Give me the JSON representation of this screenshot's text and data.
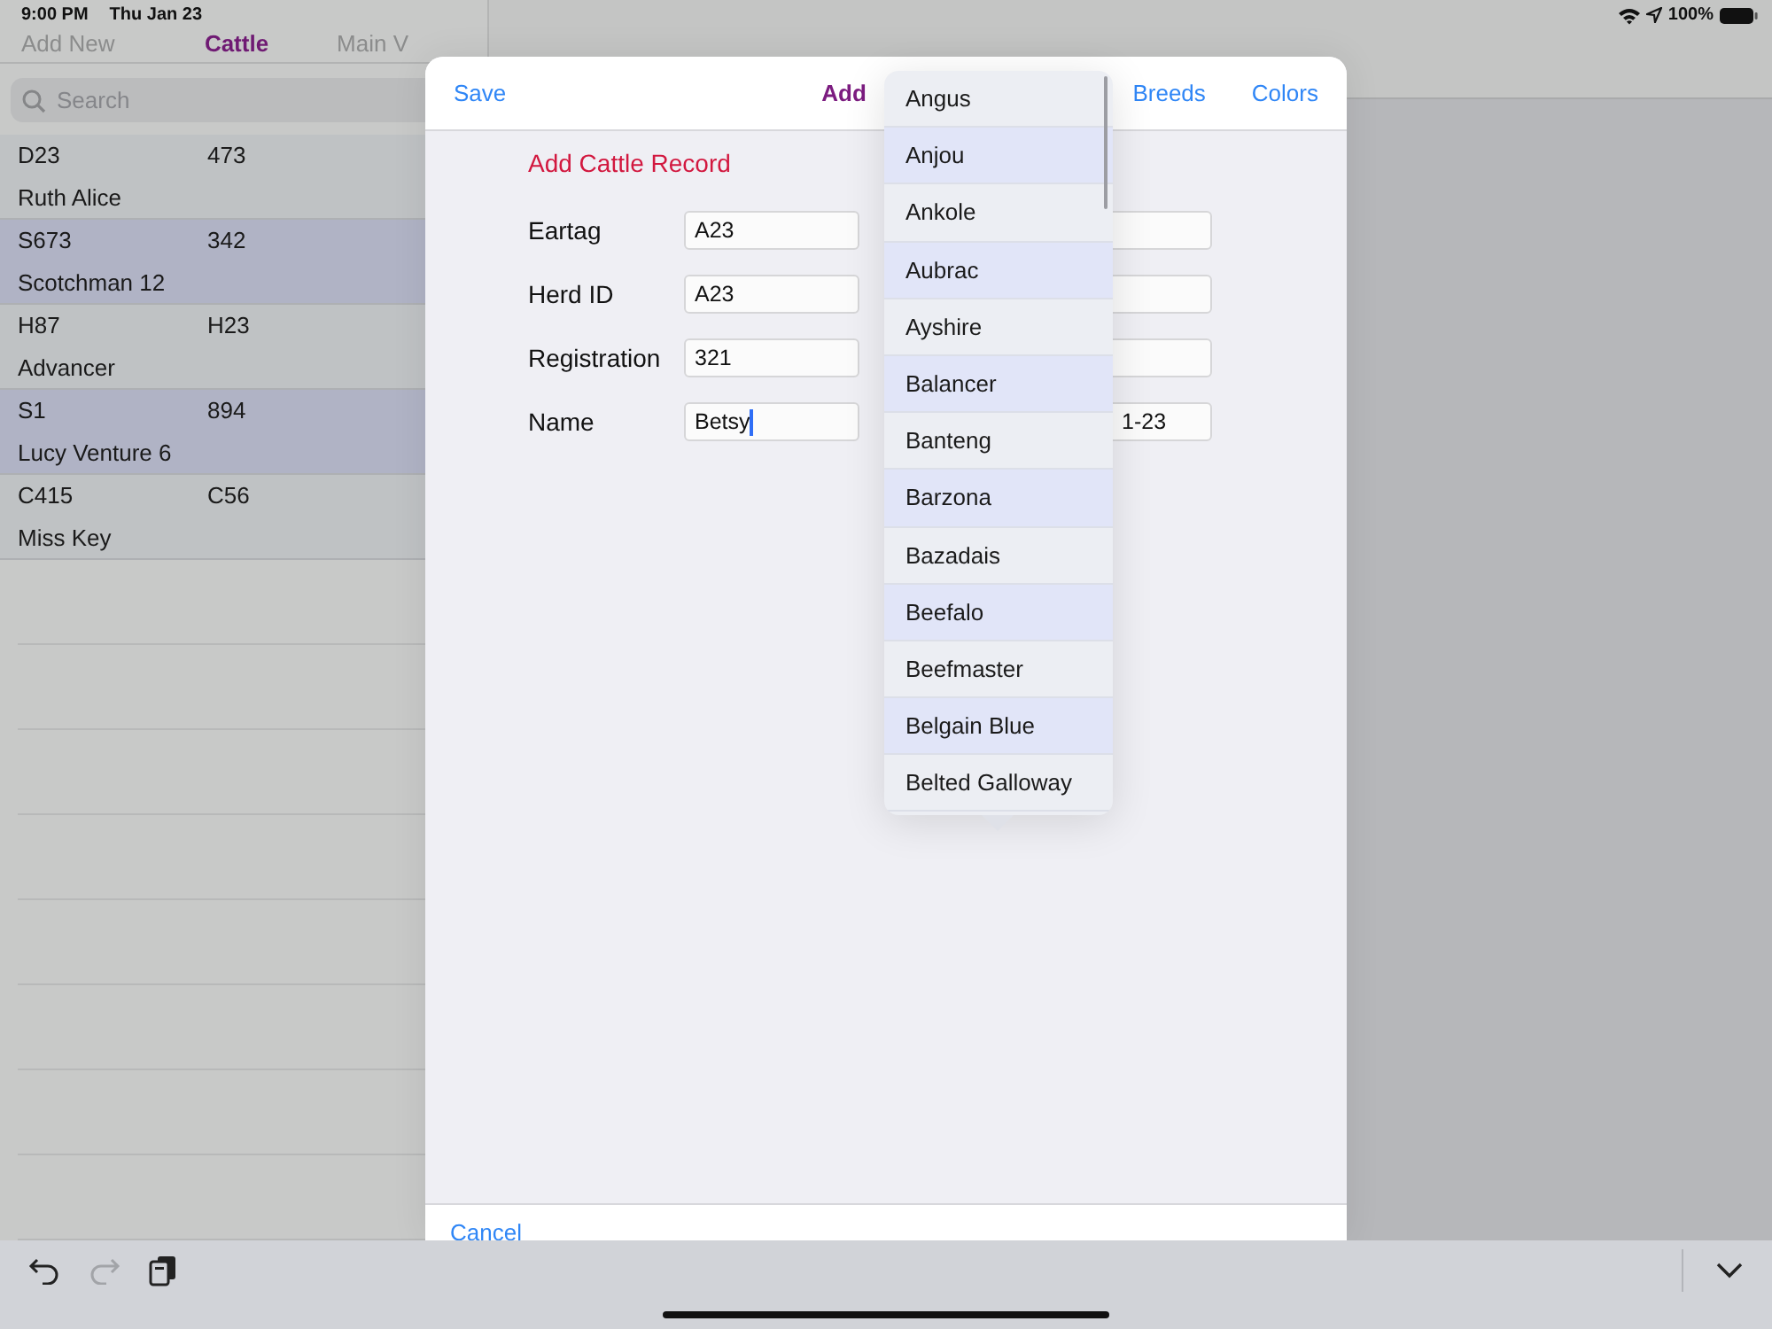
{
  "status_bar": {
    "time": "9:00 PM",
    "date": "Thu Jan 23",
    "battery": "100%"
  },
  "sidebar": {
    "tabs": [
      {
        "label": "Add New",
        "selected": false
      },
      {
        "label": "Cattle",
        "selected": true
      },
      {
        "label": "Main V",
        "selected": false
      }
    ],
    "search": {
      "placeholder": "Search"
    },
    "rows": [
      {
        "eartag": "D23",
        "herd_id": "473",
        "name": "Ruth Alice"
      },
      {
        "eartag": "S673",
        "herd_id": "342",
        "name": "Scotchman 12"
      },
      {
        "eartag": "H87",
        "herd_id": "H23",
        "name": "Advancer"
      },
      {
        "eartag": "S1",
        "herd_id": "894",
        "name": "Lucy Venture 6"
      },
      {
        "eartag": "C415",
        "herd_id": "C56",
        "name": "Miss Key"
      }
    ]
  },
  "modal": {
    "save": "Save",
    "title": "Add",
    "buttons": [
      "Breeds",
      "Colors"
    ],
    "form_title": "Add Cattle Record",
    "fields": [
      {
        "label": "Eartag",
        "value": "A23"
      },
      {
        "label": "Herd ID",
        "value": "A23"
      },
      {
        "label": "Registration",
        "value": "321"
      },
      {
        "label": "Name",
        "value": "Betsy",
        "focused": true
      }
    ],
    "right_fields": [
      {
        "kind": "blank"
      },
      {
        "kind": "blank"
      },
      {
        "kind": "blank"
      },
      {
        "kind": "filled",
        "value": "1-23"
      }
    ],
    "cancel": "Cancel"
  },
  "breed_picker": {
    "items": [
      "Angus",
      "Anjou",
      "Ankole",
      "Aubrac",
      "Ayshire",
      "Balancer",
      "Banteng",
      "Barzona",
      "Bazadais",
      "Beefalo",
      "Beefmaster",
      "Belgain Blue",
      "Belted Galloway"
    ]
  },
  "toolbar": {
    "redo_disabled": true
  }
}
